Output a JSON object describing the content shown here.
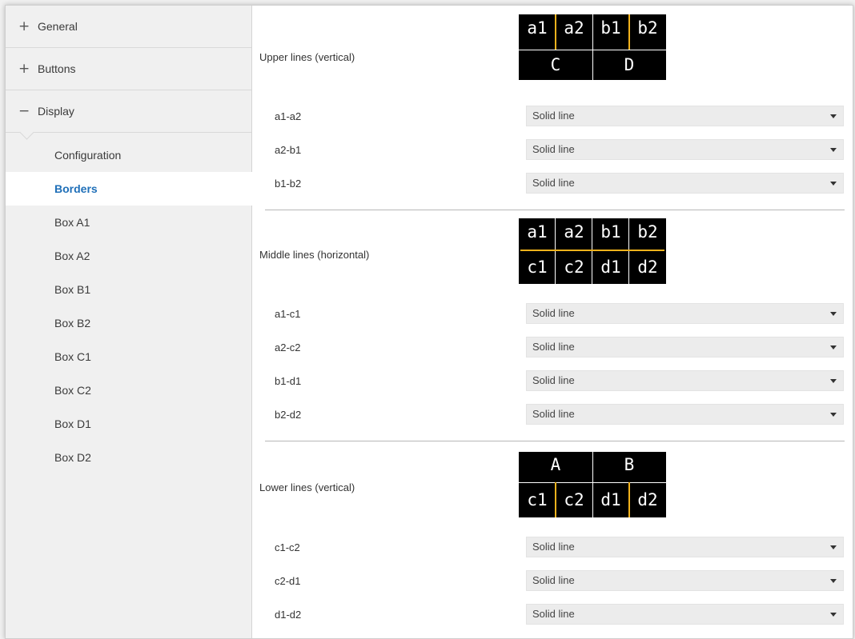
{
  "sidebar": {
    "groups": [
      {
        "sign": "+",
        "label": "General"
      },
      {
        "sign": "+",
        "label": "Buttons"
      },
      {
        "sign": "−",
        "label": "Display"
      }
    ],
    "items": [
      "Configuration",
      "Borders",
      "Box A1",
      "Box A2",
      "Box B1",
      "Box B2",
      "Box C1",
      "Box C2",
      "Box D1",
      "Box D2"
    ],
    "active_item": "Borders"
  },
  "sections": {
    "upper": {
      "title": "Upper lines (vertical)",
      "diagram": {
        "top": [
          "a1",
          "a2",
          "b1",
          "b2"
        ],
        "bottom": [
          "C",
          "D"
        ]
      },
      "rows": [
        {
          "label": "a1-a2",
          "value": "Solid line"
        },
        {
          "label": "a2-b1",
          "value": "Solid line"
        },
        {
          "label": "b1-b2",
          "value": "Solid line"
        }
      ]
    },
    "middle": {
      "title": "Middle lines (horizontal)",
      "diagram": {
        "top": [
          "a1",
          "a2",
          "b1",
          "b2"
        ],
        "bottom": [
          "c1",
          "c2",
          "d1",
          "d2"
        ]
      },
      "rows": [
        {
          "label": "a1-c1",
          "value": "Solid line"
        },
        {
          "label": "a2-c2",
          "value": "Solid line"
        },
        {
          "label": "b1-d1",
          "value": "Solid line"
        },
        {
          "label": "b2-d2",
          "value": "Solid line"
        }
      ]
    },
    "lower": {
      "title": "Lower lines (vertical)",
      "diagram": {
        "top": [
          "A",
          "B"
        ],
        "bottom": [
          "c1",
          "c2",
          "d1",
          "d2"
        ]
      },
      "rows": [
        {
          "label": "c1-c2",
          "value": "Solid line"
        },
        {
          "label": "c2-d1",
          "value": "Solid line"
        },
        {
          "label": "d1-d2",
          "value": "Solid line"
        }
      ]
    }
  },
  "colors": {
    "accent": "#1f6fb8",
    "highlight_line": "#f2b21c",
    "diagram_bg": "#000000"
  },
  "icons": {
    "expand": "plus-icon",
    "collapse": "minus-icon",
    "dropdown": "chevron-down-icon"
  }
}
